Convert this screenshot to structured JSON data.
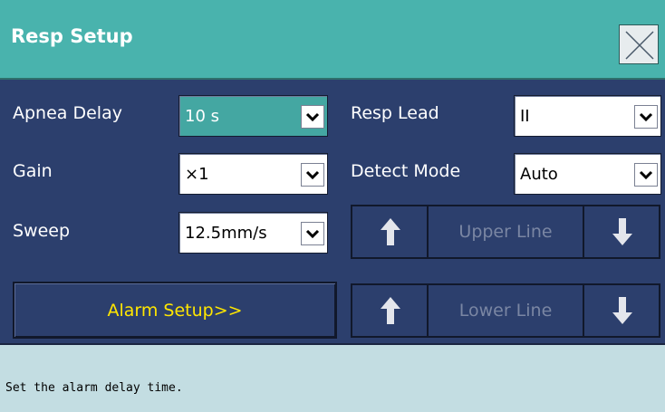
{
  "window": {
    "title": "Resp Setup",
    "close_icon": "close-icon"
  },
  "settings": {
    "apnea_delay": {
      "label": "Apnea Delay",
      "value": "10 s"
    },
    "gain": {
      "label": "Gain",
      "value": "×1"
    },
    "sweep": {
      "label": "Sweep",
      "value": "12.5mm/s"
    },
    "resp_lead": {
      "label": "Resp Lead",
      "value": "II"
    },
    "detect_mode": {
      "label": "Detect Mode",
      "value": "Auto"
    }
  },
  "buttons": {
    "alarm_setup": "Alarm Setup>>",
    "upper_line": "Upper Line",
    "lower_line": "Lower Line"
  },
  "status": {
    "message": "Set the alarm delay time."
  },
  "colors": {
    "titlebar": "#49b3ad",
    "panel": "#2c3f6d",
    "active_field": "#44a7a2",
    "alarm_text": "#ffe600",
    "disabled_text": "#7a86a3",
    "status_bar": "#c3dde2"
  }
}
